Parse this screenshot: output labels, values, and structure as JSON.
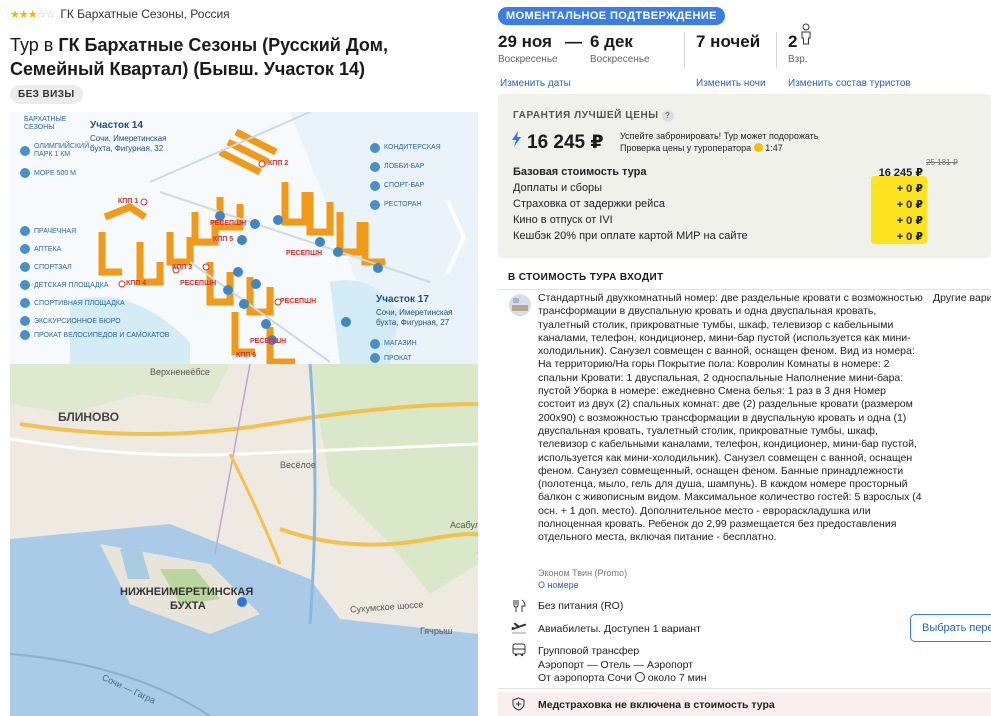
{
  "hotel": {
    "rating_stars": 3,
    "breadcrumb": "ГК Бархатные Сезоны, Россия",
    "title_prefix": "Тур в ",
    "title_name": "ГК Бархатные Сезоны (Русский Дом, Семейный Квартал) (Бывш. Участок 14)",
    "visa_badge": "БЕЗ ВИЗЫ"
  },
  "scheme": {
    "logo": [
      "БАРХАТНЫЕ",
      "СЕЗОНЫ"
    ],
    "plot14_title": "Участок 14",
    "plot14_addr": [
      "Сочи, Имеретинская",
      "бухта, Фигурная, 32"
    ],
    "plot17_title": "Участок 17",
    "plot17_addr": [
      "Сочи, Имеретинская",
      "бухта, Фигурная, 27"
    ],
    "legend_left": [
      "ОЛИМПИЙСКИЙ ПАРК 1 КМ",
      "МОРЕ 500 М",
      "ПРАЧЕЧНАЯ",
      "АПТЕКА",
      "СПОРТЗАЛ",
      "ДЕТСКАЯ ПЛОЩАДКА",
      "СПОРТИВНАЯ ПЛОЩАДКА",
      "ЭКСКУРСИОННОЕ БЮРО",
      "ПРОКАТ ВЕЛОСИПЕДОВ И САМОКАТОВ"
    ],
    "legend_right": [
      "КОНДИТЕРСКАЯ",
      "ЛОББИ-БАР",
      "СПОРТ-БАР",
      "РЕСТОРАН",
      "МАГАЗИН",
      "ПРОКАТ"
    ],
    "kpp": [
      "КПП 1",
      "КПП 2",
      "КПП 3",
      "КПП 4",
      "КПП 5",
      "КПП 6"
    ],
    "reception": "РЕСЕПШН"
  },
  "map": {
    "labels": [
      "Верхненеёбсе",
      "БЛИНОВО",
      "Весёлое",
      "Асабулё",
      "НИЖНЕИМЕРЕТИНСКАЯ",
      "БУХТА",
      "Сухумское шоссе",
      "Гячрыш",
      "Сочи — Гагра"
    ]
  },
  "booking": {
    "badge": "МОМЕНТАЛЬНОЕ ПОДТВЕРЖДЕНИЕ",
    "date_from": "29 ноя",
    "dash": "—",
    "date_to": "6 дек",
    "weekday_from": "Воскресенье",
    "weekday_to": "Воскресенье",
    "nights": "7 ночей",
    "adults": "2",
    "adults_label": "Взр.",
    "change_dates": "Изменить даты",
    "change_nights": "Изменить ночи",
    "change_tourists": "Изменить состав туристов"
  },
  "price": {
    "guarantee": "ГАРАНТИЯ ЛУЧШЕЙ ЦЕНЫ",
    "q": "?",
    "total": "16 245 ₽",
    "hurry_1": "Успейте забронировать! Тур может подорожать",
    "hurry_2": "Проверка цены у туроператора",
    "timer": "1:47",
    "old_price": "25 181 ₽",
    "lines": [
      {
        "name": "Базовая стоимость тура",
        "value": "16 245 ₽"
      },
      {
        "name": "Доплаты и сборы",
        "value": "+ 0 ₽"
      },
      {
        "name": "Страховка от задержки рейса",
        "value": "+ 0 ₽"
      },
      {
        "name": "Кино в отпуск от IVI",
        "value": "+ 0 ₽"
      },
      {
        "name": "Кешбэк 20% при оплате картой МИР на сайте",
        "value": "+ 0 ₽"
      }
    ]
  },
  "included": {
    "heading": "В СТОИМОСТЬ ТУРА ВХОДИТ",
    "room_desc": "Стандартный двухкомнатный номер: две раздельные кровати с возможностью трансформации в двуспальную кровать и одна двуспальная кровать, туалетный столик, прикроватные тумбы, шкаф, телевизор с кабельными каналами, телефон, кондиционер, мини-бар пустой (используется как мини-холодильник). Санузел совмещен с ванной, оснащен феном. Вид из номера: На территорию/На горы Покрытие пола: Ковролин Комнаты в номере: 2 спальни Кровати: 1 двуспальная, 2 односпальные Наполнение мини-бара: пустой Уборка в номере: ежедневно Смена белья: 1 раз в 3 дня Номер состоит из двух (2) спальных комнат: две (2) раздельные кровати (размером 200х90) с возможностью трансформации в двуспальную кровать и одна (1) двуспальная кровать, туалетный столик, прикроватные тумбы, шкаф, телевизор с кабельными каналами, телефон, кондиционер, мини-бар пустой, используется как мини-холодильник). Санузел совмещен с ванной, оснащен феном. Санузел совмещенный, оснащен феном. Банные принадлежности (полотенца, мыло, гель для душа, шампунь). В каждом номере просторный балкон с живописным видом. Максимальное количество гостей: 5 взрослых (4 осн. + 1 доп. место). Дополнительное место - евpoраскладушка или полноценная кровать. Ребенок до 2,99 размещается без предоставления отдельного места, включая питание - бесплатно.",
    "other": "Другие вари",
    "room_type": "Эконом Твин (Promo)",
    "about_room": "О номере",
    "meal": "Без питания (RO)",
    "flights": "Авиабилеты. Доступен 1 вариант",
    "choose_btn": "Выбрать пере",
    "transfer_title": "Групповой трансфер",
    "transfer_route": "Аэропорт — Отель — Аэропорт",
    "transfer_from": "От аэропорта Сочи",
    "transfer_time": "около 7 мин",
    "insurance": "Медстраховка не включена в стоимость тура"
  }
}
